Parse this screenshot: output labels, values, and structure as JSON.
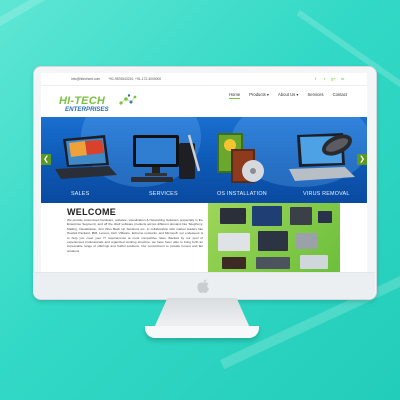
{
  "site": {
    "top_bar": {
      "email": "info@hitechent.com",
      "phone": "+91-9876543210, +91-172-4000000",
      "social_icons": [
        "facebook-icon",
        "twitter-icon",
        "google-plus-icon",
        "linkedin-icon"
      ]
    },
    "logo": {
      "line1": "HI-TECH",
      "line2": "ENTERPRISES"
    },
    "nav": [
      {
        "label": "Home",
        "active": true
      },
      {
        "label": "Products ▾",
        "active": false
      },
      {
        "label": "About Us ▾",
        "active": false
      },
      {
        "label": "Services",
        "active": false
      },
      {
        "label": "Contact",
        "active": false
      }
    ],
    "slider": {
      "prev_arrow": "❮",
      "next_arrow": "❯",
      "captions": [
        "SALES",
        "SERVICES",
        "OS INSTALLATION",
        "VIRUS REMOVAL"
      ]
    },
    "welcome": {
      "title": "WELCOME",
      "text": "We provide customised hardware, software, visualization & Networking Solutions (especially in the Enterprise Segment), and off the shelf software products across different domains like Telephony, Mailing, Visualization, Anti Virus Back Up Solutions etc. In collaboration with market leaders like Hewlett Packard, IBM, Lenovo, Dell, VMware, Extreme networks, and Microsoft; our endeavour is to help you meet your IT requirements at most competitive rates. Backed by our pool of experienced professionals and organized working structure, we have been able to bring forth an impeccable range of offerings and fruitful solutions. Our commitment to provide honest and fair solutions"
    }
  },
  "colors": {
    "background": "#33d9c6",
    "brand_green": "#7bc142",
    "brand_blue": "#2a6fb5",
    "slider_blue": "#0d58b4"
  }
}
